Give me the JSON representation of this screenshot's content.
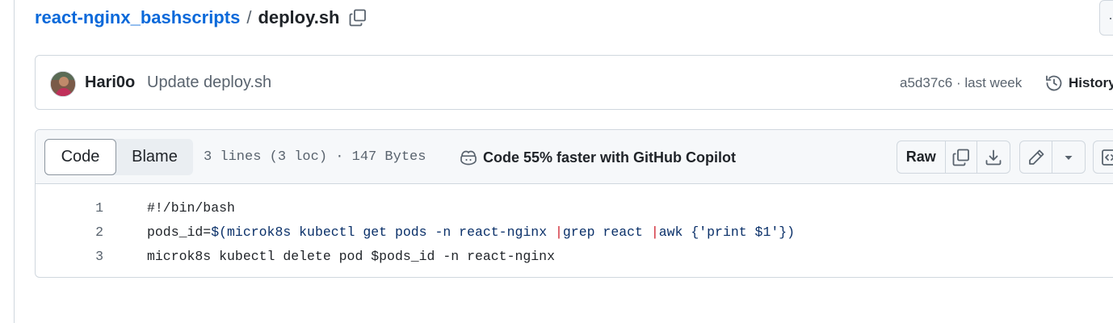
{
  "breadcrumb": {
    "repo": "react-nginx_bashscripts",
    "separator": "/",
    "file": "deploy.sh"
  },
  "header_more": {
    "label": "·"
  },
  "commit": {
    "author": "Hari0o",
    "message": "Update deploy.sh",
    "sha": "a5d37c6",
    "dot": "·",
    "time": "last week",
    "history_label": "History"
  },
  "file": {
    "tabs": {
      "code": "Code",
      "blame": "Blame"
    },
    "info": "3 lines (3 loc) · 147 Bytes",
    "copilot": "Code 55% faster with GitHub Copilot",
    "raw_label": "Raw",
    "lines": [
      {
        "num": "1",
        "segments": [
          {
            "t": "#!/bin/bash",
            "k": "plain"
          }
        ]
      },
      {
        "num": "2",
        "segments": [
          {
            "t": "pods_id=",
            "k": "plain"
          },
          {
            "t": "$(",
            "k": "str"
          },
          {
            "t": "microk8s kubectl get pods -n react-nginx ",
            "k": "str"
          },
          {
            "t": "|",
            "k": "op"
          },
          {
            "t": "grep react ",
            "k": "str"
          },
          {
            "t": "|",
            "k": "op"
          },
          {
            "t": "awk {",
            "k": "str"
          },
          {
            "t": "'print $1'",
            "k": "str"
          },
          {
            "t": "})",
            "k": "str"
          }
        ]
      },
      {
        "num": "3",
        "segments": [
          {
            "t": "microk8s kubectl delete pod $pods_id -n react-nginx",
            "k": "plain"
          }
        ]
      }
    ]
  },
  "icons": {
    "copy_path": "copy-icon",
    "history": "history-icon",
    "copilot": "copilot-icon",
    "copy_raw": "copy-icon",
    "download": "download-icon",
    "edit": "pencil-icon",
    "more_edit": "triangle-down-icon",
    "symbols": "code-square-icon"
  },
  "colors": {
    "link": "#0969da",
    "muted": "#59636e",
    "border": "#d0d7de",
    "header_bg": "#f6f8fa",
    "string": "#0a3069",
    "operator": "#cf222e"
  }
}
